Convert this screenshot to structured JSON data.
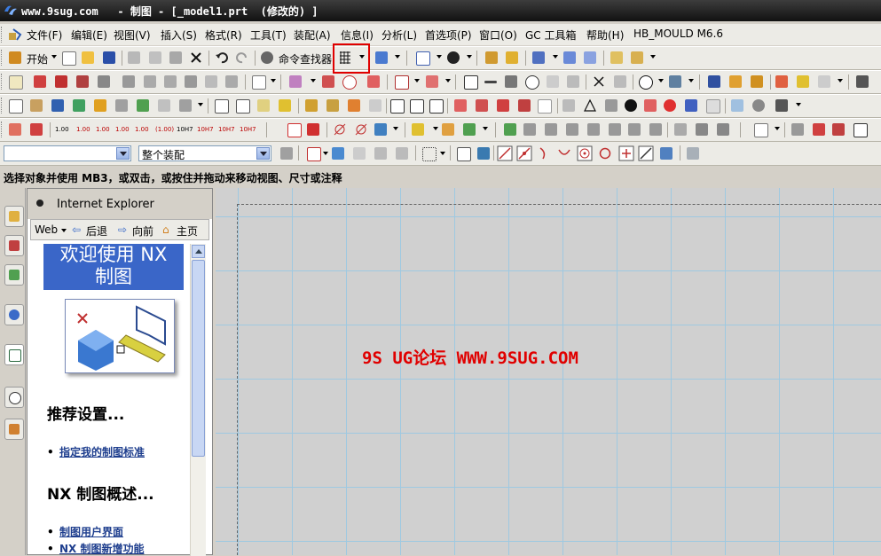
{
  "window": {
    "title": "www.9sug.com   - 制图 - [_model1.prt  (修改的) ]"
  },
  "menubar": {
    "items": [
      "文件(F)",
      "编辑(E)",
      "视图(V)",
      "插入(S)",
      "格式(R)",
      "工具(T)",
      "装配(A)",
      "信息(I)",
      "分析(L)",
      "首选项(P)",
      "窗口(O)",
      "GC 工具箱",
      "帮助(H)",
      "HB_MOULD M6.6"
    ]
  },
  "toolbar": {
    "start_label": "开始",
    "command_finder_label": "命令查找器"
  },
  "tolerance_labels": [
    "1.00",
    "1.00",
    "1.00",
    "1.00",
    "1.00",
    "(1.00)",
    "10H7",
    "10H7",
    "10H7",
    "10H7"
  ],
  "selection": {
    "filter_value": "",
    "scope_value": "整个装配"
  },
  "status": {
    "prompt": "选择对象并使用 MB3，或双击，或按住并拖动来移动视图、尺寸或注释"
  },
  "resource_panel": {
    "title": "Internet Explorer",
    "nav": {
      "web": "Web",
      "back": "后退",
      "forward": "向前",
      "home": "主页"
    },
    "banner": [
      "欢迎使用 NX",
      "制图"
    ],
    "section1": "推荐设置...",
    "link1": "指定我的制图标准",
    "section2": "NX 制图概述...",
    "link2": "制图用户界面",
    "link3": "NX 制图新增功能"
  },
  "canvas": {
    "watermark": "9S UG论坛 WWW.9SUG.COM"
  },
  "colors": {
    "highlight": "#e00000",
    "grid": "#9fc9e1",
    "banner": "#3a66c8",
    "link": "#1e3e8e"
  }
}
